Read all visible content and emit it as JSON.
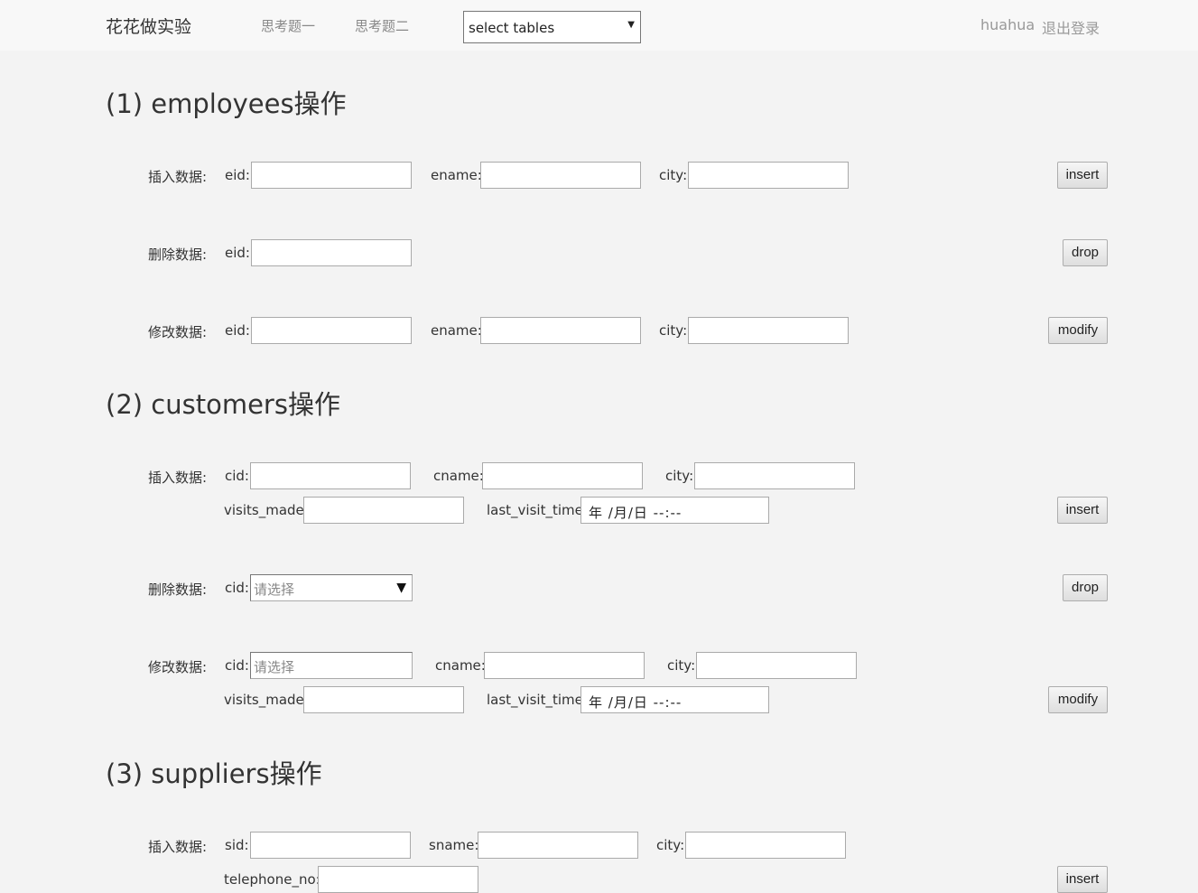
{
  "nav": {
    "brand": "花花做实验",
    "links": [
      "思考题一",
      "思考题二"
    ],
    "select_label": "select tables",
    "username": "huahua",
    "logout": "退出登录"
  },
  "row_labels": {
    "insert": "插入数据:",
    "drop": "删除数据:",
    "modify": "修改数据:"
  },
  "buttons": {
    "insert": "insert",
    "drop": "drop",
    "modify": "modify"
  },
  "employees": {
    "title": "(1) employees操作",
    "fields": {
      "eid": "eid:",
      "ename": "ename:",
      "city": "city:"
    }
  },
  "customers": {
    "title": "(2) customers操作",
    "fields": {
      "cid": "cid:",
      "cname": "cname:",
      "city": "city:",
      "visits_made": "visits_made:",
      "last_visit_time": "last_visit_time:"
    },
    "datetime_placeholder": "年 /月/日 --:--",
    "select_placeholder": "请选择"
  },
  "suppliers": {
    "title": "(3) suppliers操作",
    "fields": {
      "sid": "sid:",
      "sname": "sname:",
      "city": "city:",
      "telephone_no": "telephone_no:"
    }
  }
}
